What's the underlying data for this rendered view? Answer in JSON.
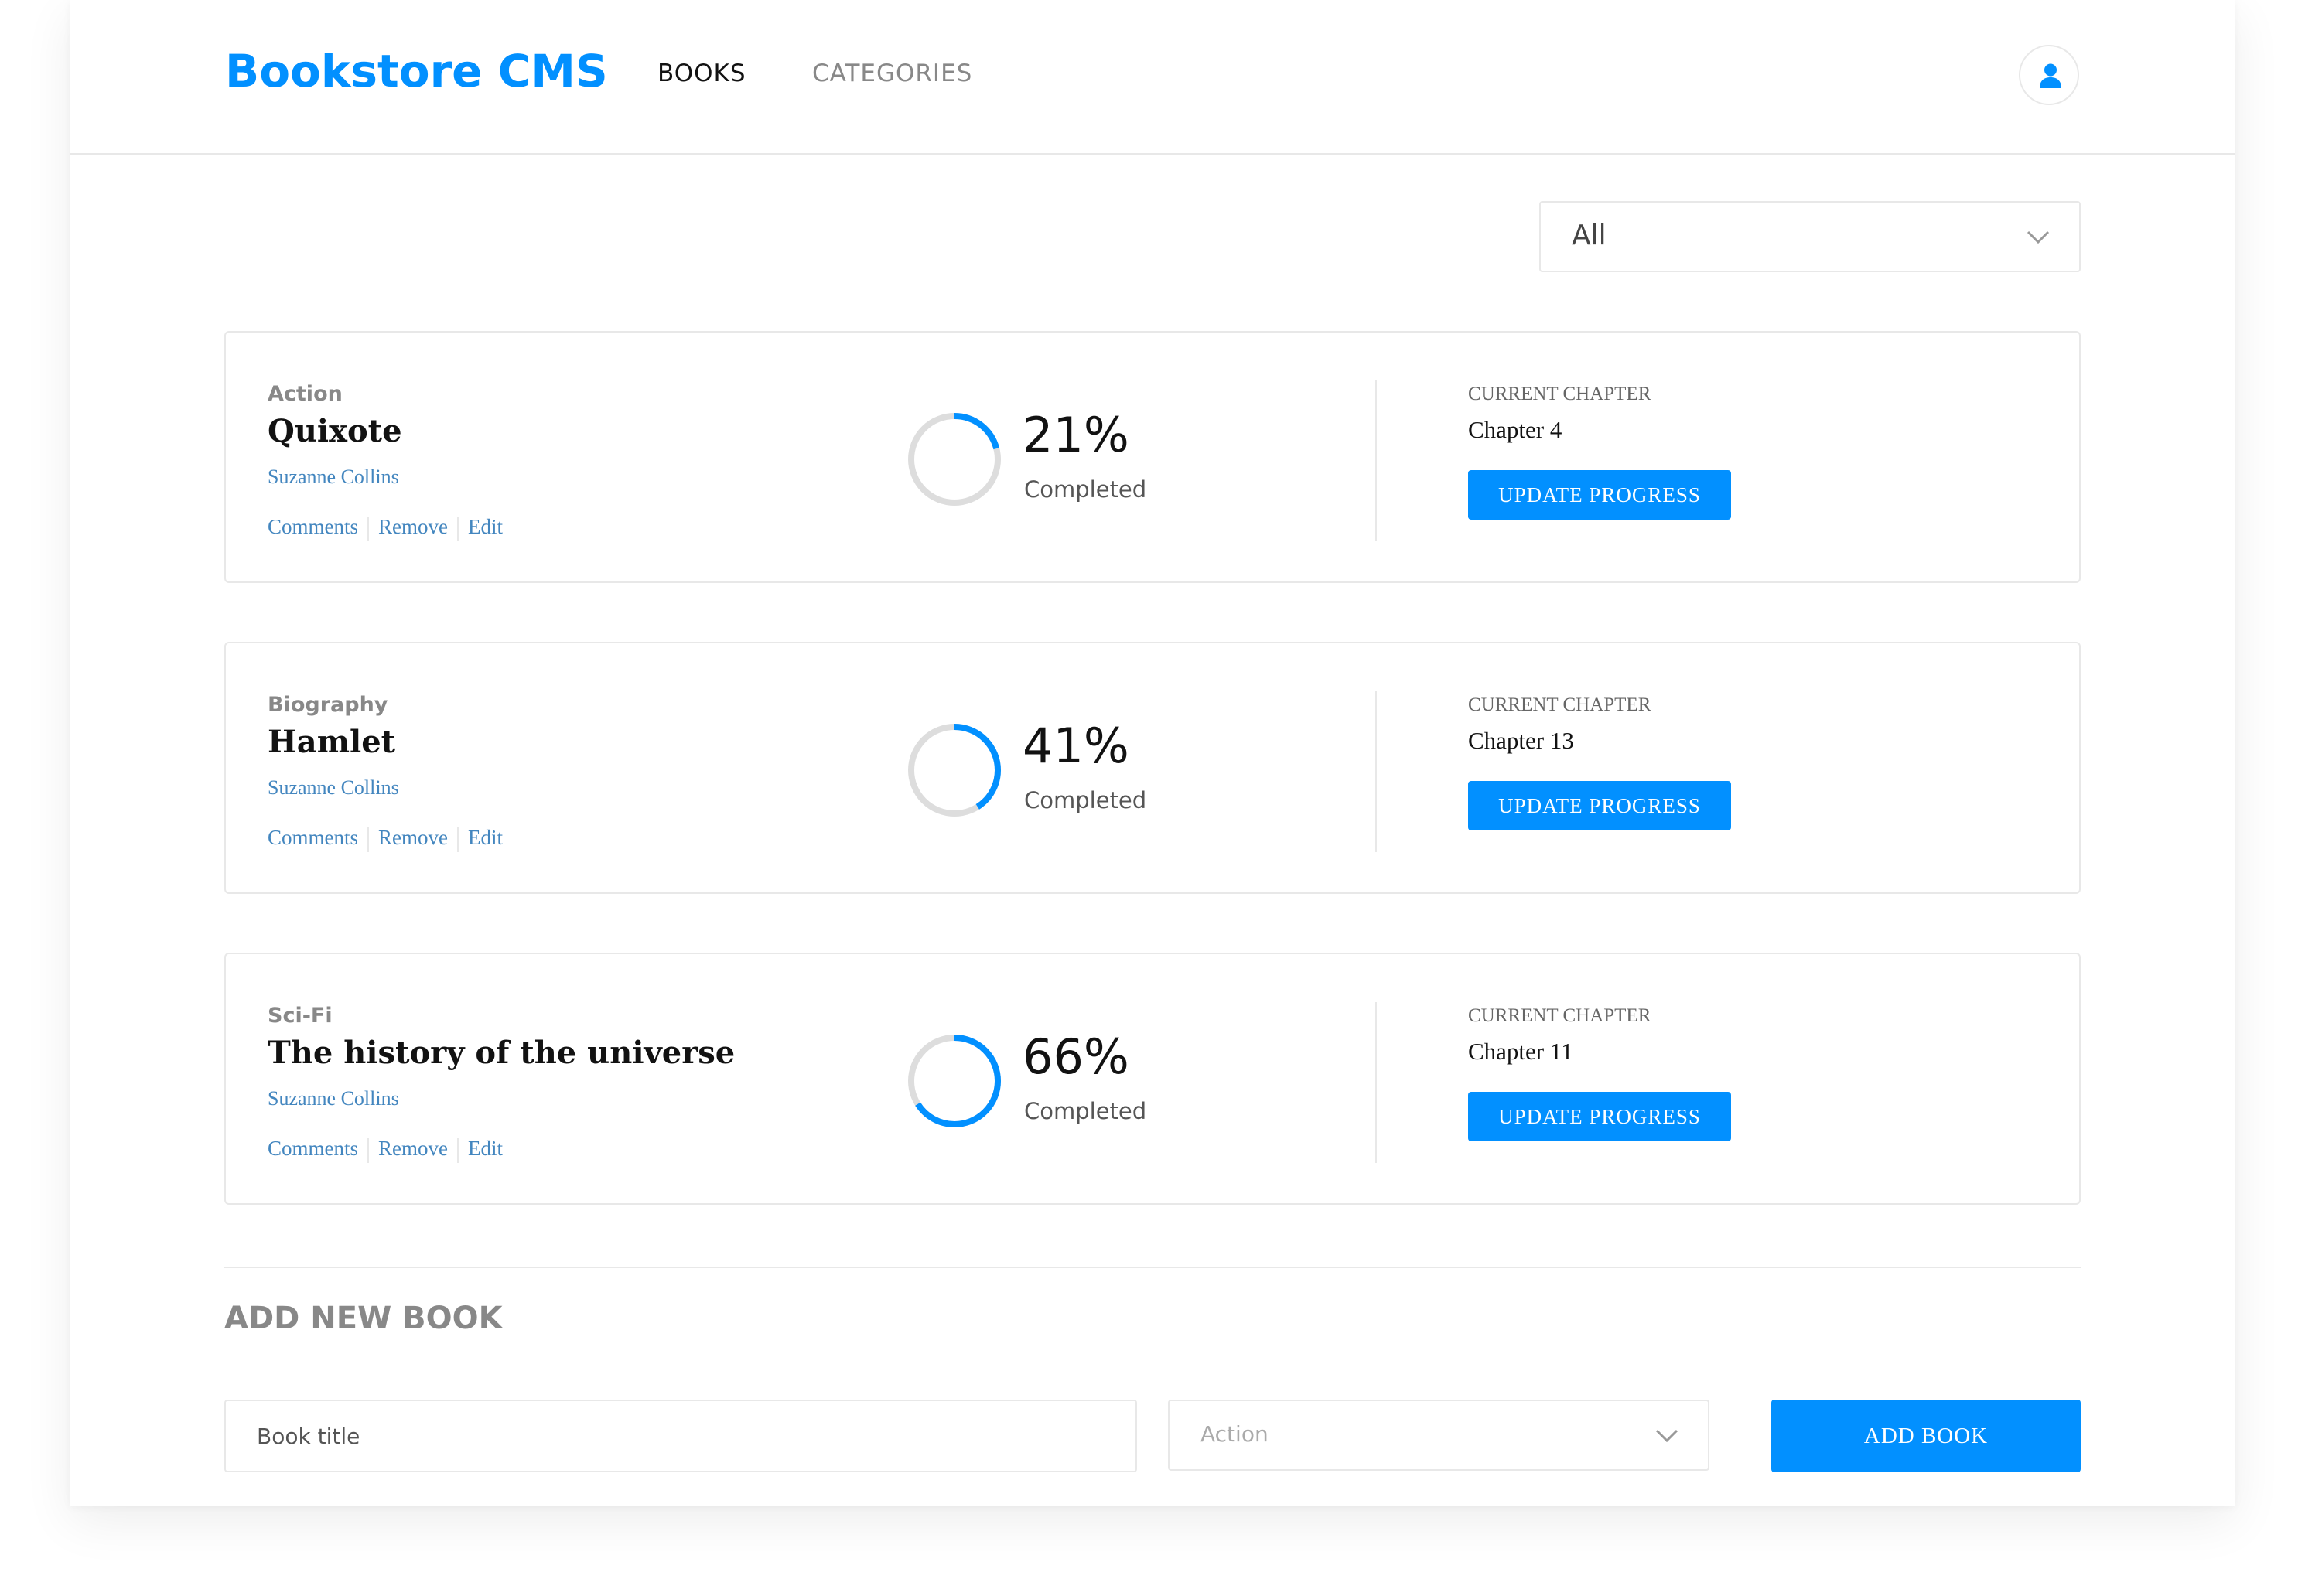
{
  "app": {
    "brand": "Bookstore CMS",
    "accent_color": "#0290ff",
    "link_color": "#4386bf"
  },
  "nav": {
    "books": "BOOKS",
    "categories": "CATEGORIES"
  },
  "header": {
    "avatar_icon": "user-icon"
  },
  "filter": {
    "selected": "All",
    "icon": "chevron-down-icon"
  },
  "books": [
    {
      "genre": "Action",
      "title": "Quixote",
      "author": "Suzanne Collins",
      "actions": [
        "Comments",
        "Remove",
        "Edit"
      ],
      "progress": 21,
      "percent_label": "21%",
      "completed_label": "Completed",
      "chapter_label": "CURRENT CHAPTER",
      "chapter": "Chapter 4",
      "update_label": "UPDATE PROGRESS"
    },
    {
      "genre": "Biography",
      "title": "Hamlet",
      "author": "Suzanne Collins",
      "actions": [
        "Comments",
        "Remove",
        "Edit"
      ],
      "progress": 41,
      "percent_label": "41%",
      "completed_label": "Completed",
      "chapter_label": "CURRENT CHAPTER",
      "chapter": "Chapter 13",
      "update_label": "UPDATE PROGRESS"
    },
    {
      "genre": "Sci-Fi",
      "title": "The history of the universe",
      "author": "Suzanne Collins",
      "actions": [
        "Comments",
        "Remove",
        "Edit"
      ],
      "progress": 66,
      "percent_label": "66%",
      "completed_label": "Completed",
      "chapter_label": "CURRENT CHAPTER",
      "chapter": "Chapter 11",
      "update_label": "UPDATE PROGRESS"
    }
  ],
  "form": {
    "title": "ADD NEW BOOK",
    "title_placeholder": "Book title",
    "category_selected": "Action",
    "submit_label": "ADD BOOK"
  }
}
